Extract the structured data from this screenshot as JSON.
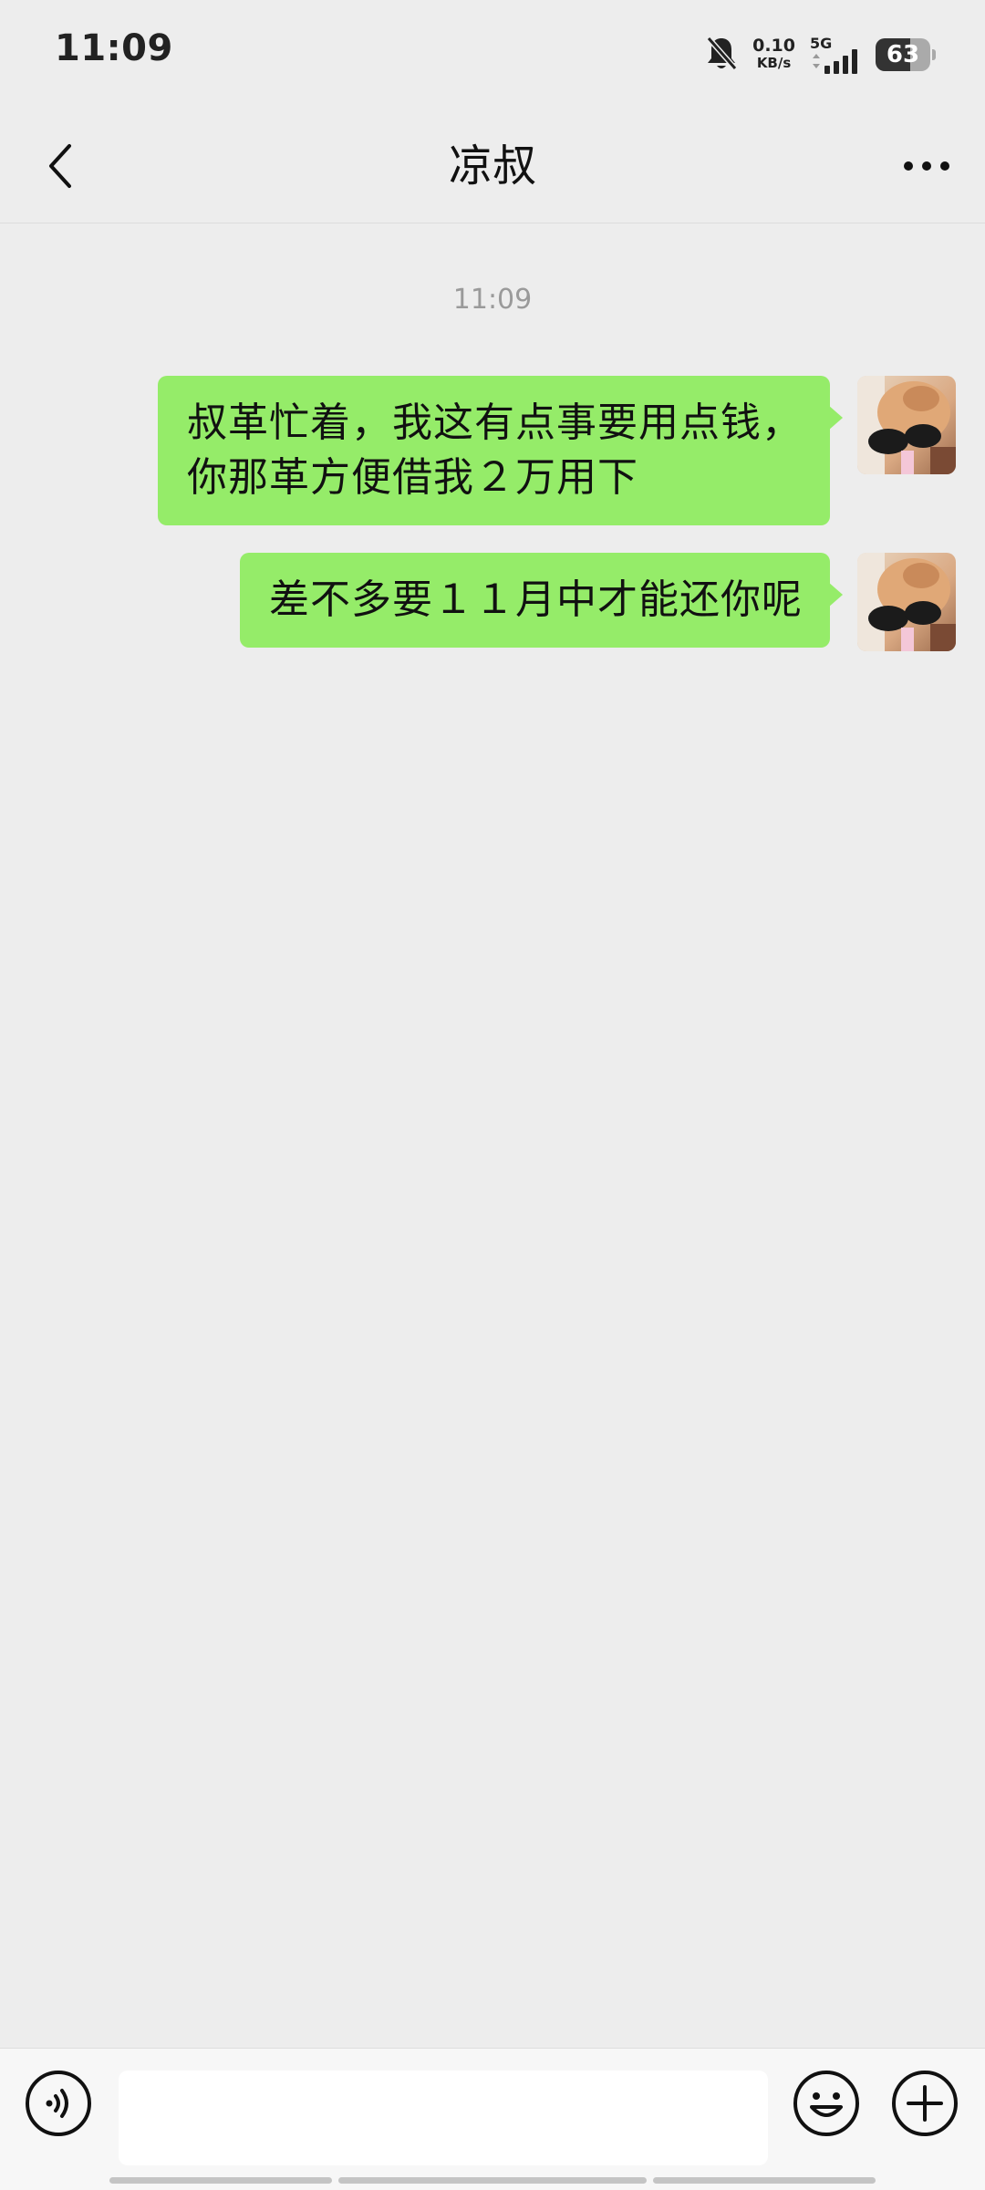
{
  "status_bar": {
    "time": "11:09",
    "net_speed_value": "0.10",
    "net_speed_unit": "KB/s",
    "network_type": "5G",
    "battery_level": "63",
    "icons": [
      "bell-muted-icon",
      "signal-icon",
      "battery-icon"
    ]
  },
  "nav": {
    "title": "凉叔",
    "back_icon": "chevron-left-icon",
    "more_icon": "more-dots-icon"
  },
  "chat": {
    "timestamp": "11:09",
    "messages": [
      {
        "sender": "self",
        "line1": "叔革忙着，我这有点事要用点钱，",
        "line2": "你那革方便借我２万用下"
      },
      {
        "sender": "self",
        "line1": "差不多要１１月中才能还你呢"
      }
    ]
  },
  "input_bar": {
    "text_value": "",
    "icons": [
      "voice-icon",
      "emoji-icon",
      "plus-icon"
    ]
  },
  "colors": {
    "background": "#ededed",
    "bubble_self": "#95ec69",
    "input_bar_bg": "#f7f7f7"
  }
}
